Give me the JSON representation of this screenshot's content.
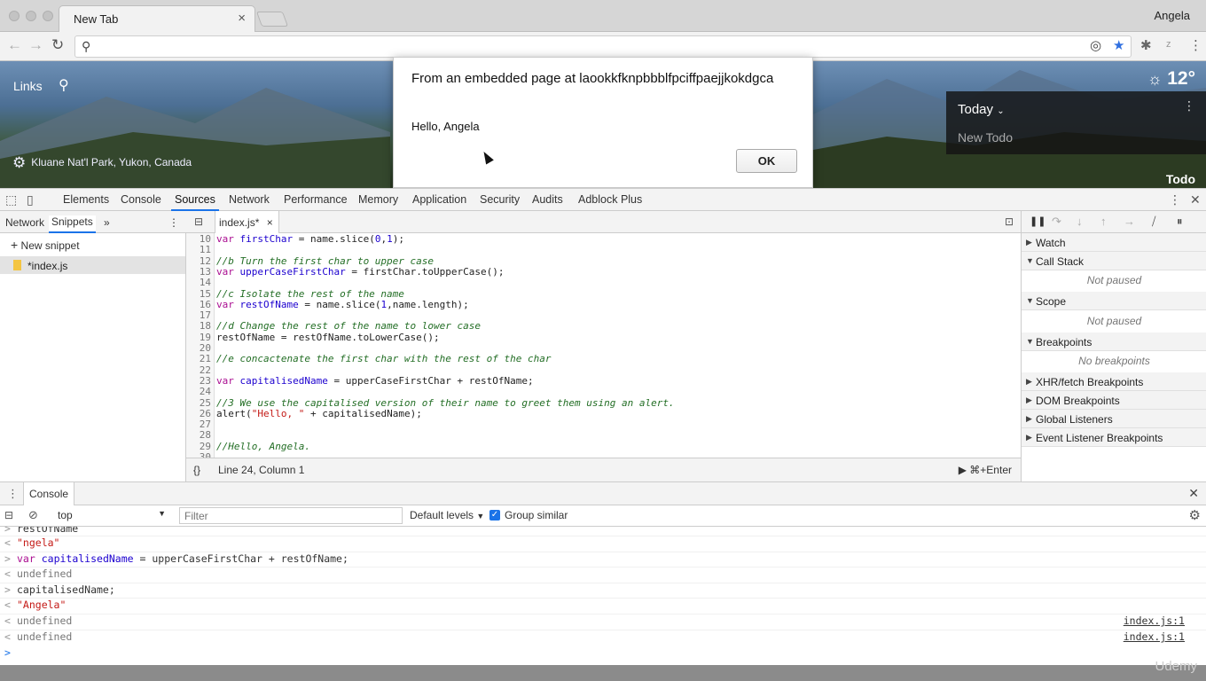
{
  "browser": {
    "tab_title": "New Tab",
    "tab_close": "×",
    "profile_name": "Angela",
    "address_value": ""
  },
  "page": {
    "links_label": "Links",
    "location_caption": "Kluane Nat'l Park, Yukon, Canada",
    "temperature": "12°",
    "todo_today": "Today",
    "todo_more": "⋮",
    "todo_placeholder": "New Todo",
    "todo_label": "Todo"
  },
  "dialog": {
    "heading": "From an embedded page at laookkfknpbbblfpciffpaejjkokdgca",
    "message": "Hello, Angela",
    "ok_label": "OK"
  },
  "devtools": {
    "tabs": [
      "Elements",
      "Console",
      "Sources",
      "Network",
      "Performance",
      "Memory",
      "Application",
      "Security",
      "Audits",
      "Adblock Plus"
    ],
    "active_tab": "Sources",
    "left_tabs": [
      "Network",
      "Snippets"
    ],
    "new_snippet": "New snippet",
    "file_name": "*index.js",
    "editor_tab": "index.js*",
    "status_position": "Line 24, Column 1",
    "run_shortcut": "⌘+Enter",
    "format_icon": "{}",
    "code_lines": [
      {
        "n": "10",
        "html": "<span class=\"kw\">var</span> <span class=\"vr\">firstChar</span> = name.slice(<span class=\"nm\">0</span>,<span class=\"nm\">1</span>);"
      },
      {
        "n": "11",
        "html": ""
      },
      {
        "n": "12",
        "html": "<span class=\"cm\">//b Turn the first char to upper case</span>"
      },
      {
        "n": "13",
        "html": "<span class=\"kw\">var</span> <span class=\"vr\">upperCaseFirstChar</span> = firstChar.toUpperCase();"
      },
      {
        "n": "14",
        "html": ""
      },
      {
        "n": "15",
        "html": "<span class=\"cm\">//c Isolate the rest of the name</span>"
      },
      {
        "n": "16",
        "html": "<span class=\"kw\">var</span> <span class=\"vr\">restOfName</span> = name.slice(<span class=\"nm\">1</span>,name.length);"
      },
      {
        "n": "17",
        "html": ""
      },
      {
        "n": "18",
        "html": "<span class=\"cm\">//d Change the rest of the name to lower case</span>"
      },
      {
        "n": "19",
        "html": "restOfName = restOfName.toLowerCase();"
      },
      {
        "n": "20",
        "html": ""
      },
      {
        "n": "21",
        "html": "<span class=\"cm\">//e concactenate the first char with the rest of the char</span>"
      },
      {
        "n": "22",
        "html": ""
      },
      {
        "n": "23",
        "html": "<span class=\"kw\">var</span> <span class=\"vr\">capitalisedName</span> = upperCaseFirstChar + restOfName;"
      },
      {
        "n": "24",
        "html": ""
      },
      {
        "n": "25",
        "html": "<span class=\"cm\">//3 We use the capitalised version of their name to greet them using an alert.</span>"
      },
      {
        "n": "26",
        "html": "alert(<span class=\"st\">\"Hello, \"</span> + capitalisedName);"
      },
      {
        "n": "27",
        "html": ""
      },
      {
        "n": "28",
        "html": ""
      },
      {
        "n": "29",
        "html": "<span class=\"cm\">//Hello, Angela.</span>"
      },
      {
        "n": "30",
        "html": ""
      }
    ],
    "debugger": {
      "watch": "Watch",
      "call_stack": "Call Stack",
      "scope": "Scope",
      "not_paused": "Not paused",
      "breakpoints": "Breakpoints",
      "no_breakpoints": "No breakpoints",
      "xhr": "XHR/fetch Breakpoints",
      "dom": "DOM Breakpoints",
      "global": "Global Listeners",
      "event": "Event Listener Breakpoints"
    }
  },
  "console": {
    "title": "Console",
    "context": "top",
    "filter_placeholder": "Filter",
    "levels": "Default levels",
    "group_similar": "Group similar",
    "rows": [
      {
        "prompt": ">",
        "html": "restOfName",
        "src": ""
      },
      {
        "prompt": "<",
        "html": "<span class=\"st\">\"ngela\"</span>",
        "src": ""
      },
      {
        "prompt": ">",
        "html": "<span class=\"kw\">var</span> <span class=\"vr\">capitalisedName</span> = upperCaseFirstChar + restOfName;",
        "src": ""
      },
      {
        "prompt": "<",
        "html": "<span class=\"grey\">undefined</span>",
        "src": ""
      },
      {
        "prompt": ">",
        "html": "capitalisedName;",
        "src": ""
      },
      {
        "prompt": "<",
        "html": "<span class=\"st\">\"Angela\"</span>",
        "src": ""
      },
      {
        "prompt": "<",
        "html": "<span class=\"grey\">undefined</span>",
        "src": "index.js:1"
      },
      {
        "prompt": "<",
        "html": "<span class=\"grey\">undefined</span>",
        "src": "index.js:1"
      }
    ],
    "input_prompt": ">"
  },
  "watermark": "Udemy",
  "colors": {
    "accent": "#1a73e8",
    "keyword": "#aa0d91",
    "comment": "#236e25",
    "string": "#c41a16"
  }
}
